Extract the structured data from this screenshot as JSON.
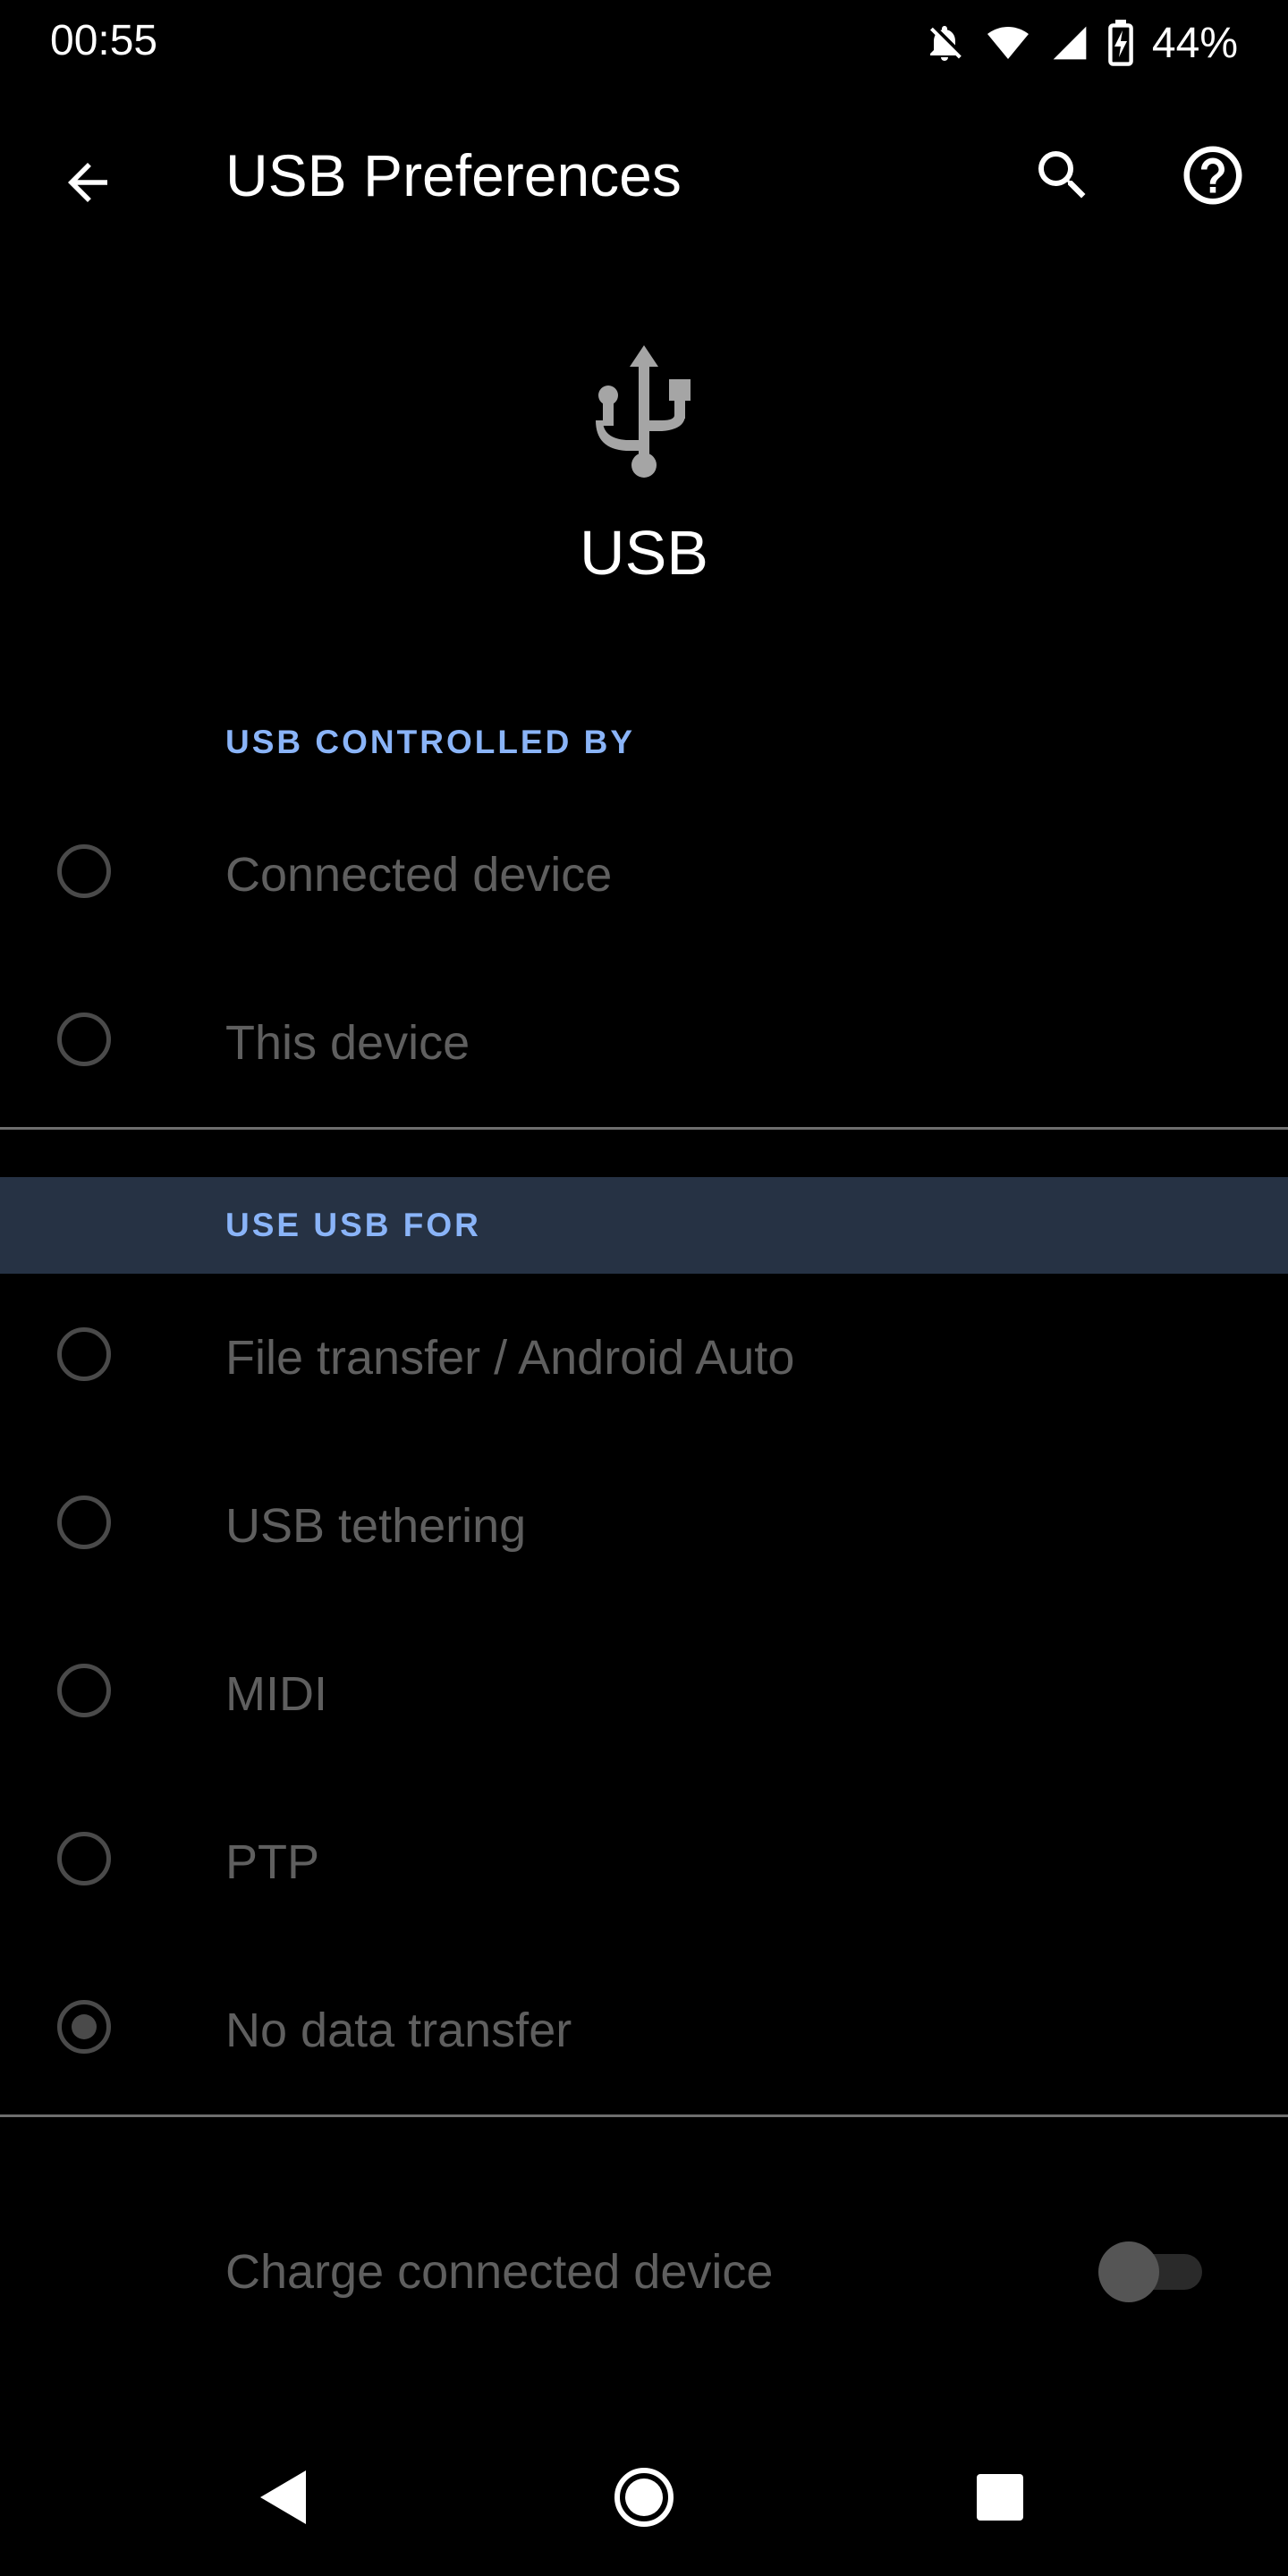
{
  "status_bar": {
    "time": "00:55",
    "battery_percent": "44%",
    "icons": [
      "notifications-off-icon",
      "wifi-icon",
      "cell-signal-icon",
      "battery-charging-icon"
    ]
  },
  "app_bar": {
    "title": "USB Preferences",
    "icons": [
      "back-arrow-icon",
      "search-icon",
      "help-icon"
    ]
  },
  "header": {
    "icon": "usb-icon",
    "title": "USB"
  },
  "usb_controlled_by": {
    "label": "USB CONTROLLED BY",
    "options": [
      {
        "label": "Connected device",
        "selected": false
      },
      {
        "label": "This device",
        "selected": false
      }
    ]
  },
  "use_usb_for": {
    "label": "USE USB FOR",
    "options": [
      {
        "label": "File transfer / Android Auto",
        "selected": false
      },
      {
        "label": "USB tethering",
        "selected": false
      },
      {
        "label": "MIDI",
        "selected": false
      },
      {
        "label": "PTP",
        "selected": false
      },
      {
        "label": "No data transfer",
        "selected": true
      }
    ]
  },
  "charge": {
    "label": "Charge connected device",
    "enabled": false
  },
  "nav_bar": {
    "icons": [
      "nav-back-icon",
      "nav-home-icon",
      "nav-recents-icon"
    ]
  },
  "colors": {
    "background": "#000000",
    "section_label": "#8ab4f8",
    "highlight_bg": "#263244",
    "disabled_text": "#5f5f5f"
  }
}
